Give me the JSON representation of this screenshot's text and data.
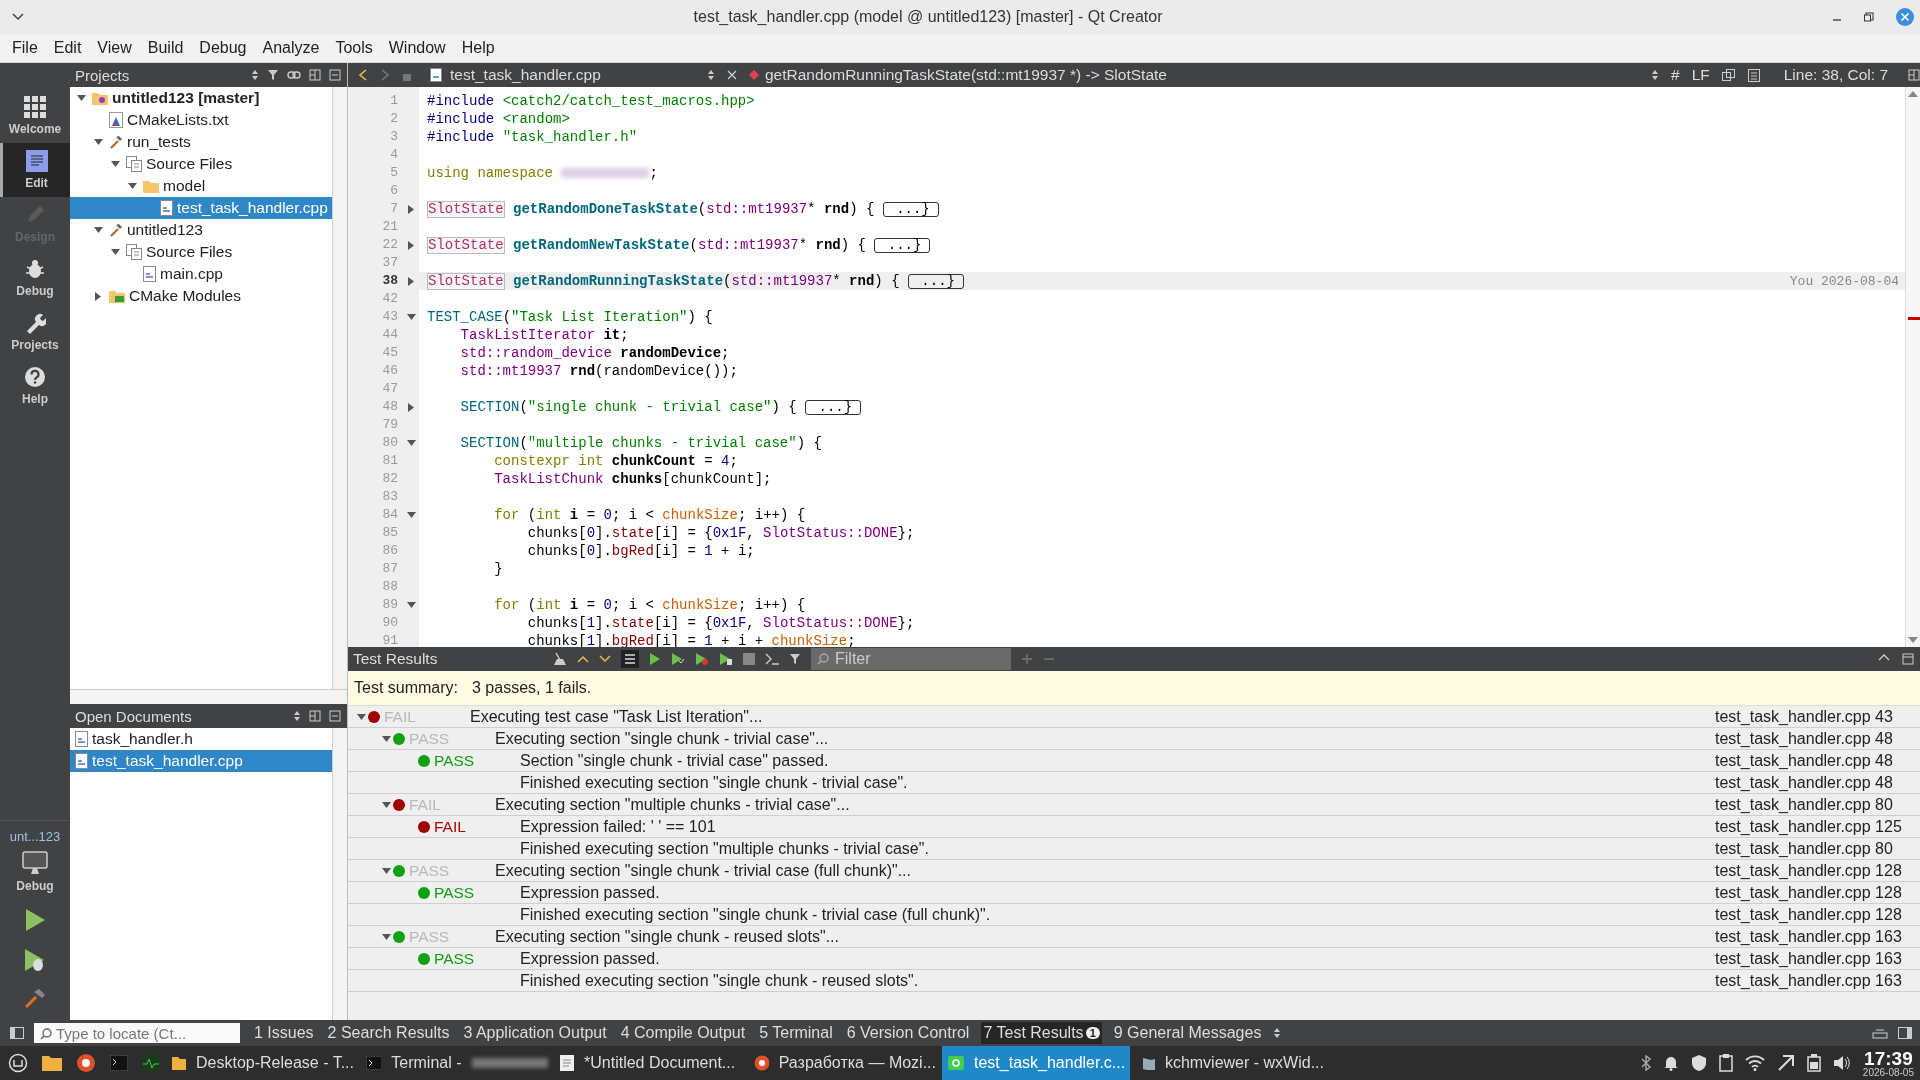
{
  "window": {
    "title": "test_task_handler.cpp (model @ untitled123) [master] - Qt Creator"
  },
  "menu": [
    "File",
    "Edit",
    "View",
    "Build",
    "Debug",
    "Analyze",
    "Tools",
    "Window",
    "Help"
  ],
  "modes": [
    {
      "label": "Welcome",
      "selected": false,
      "disabled": false
    },
    {
      "label": "Edit",
      "selected": true,
      "disabled": false
    },
    {
      "label": "Design",
      "selected": false,
      "disabled": true
    },
    {
      "label": "Debug",
      "selected": false,
      "disabled": false
    },
    {
      "label": "Projects",
      "selected": false,
      "disabled": false
    },
    {
      "label": "Help",
      "selected": false,
      "disabled": false
    }
  ],
  "kit": {
    "project": "unt...123",
    "build": "Debug"
  },
  "projects": {
    "title": "Projects",
    "tree": [
      {
        "label": "untitled123 [master]",
        "kind": "project",
        "expanded": true,
        "selected": false,
        "children": [
          {
            "label": "CMakeLists.txt",
            "kind": "cmake",
            "selected": false
          },
          {
            "label": "run_tests",
            "kind": "target",
            "expanded": true,
            "selected": false,
            "children": [
              {
                "label": "Source Files",
                "kind": "group",
                "expanded": true,
                "selected": false,
                "children": [
                  {
                    "label": "model",
                    "kind": "folder",
                    "expanded": true,
                    "selected": false,
                    "children": [
                      {
                        "label": "test_task_handler.cpp",
                        "kind": "cpp",
                        "selected": true
                      }
                    ]
                  }
                ]
              }
            ]
          },
          {
            "label": "untitled123",
            "kind": "target",
            "expanded": true,
            "selected": false,
            "children": [
              {
                "label": "Source Files",
                "kind": "group",
                "expanded": true,
                "selected": false,
                "children": [
                  {
                    "label": "main.cpp",
                    "kind": "cpp",
                    "selected": false
                  }
                ]
              }
            ]
          },
          {
            "label": "CMake Modules",
            "kind": "modules",
            "expanded": false,
            "selected": false
          }
        ]
      }
    ]
  },
  "open_documents": {
    "title": "Open Documents",
    "items": [
      {
        "label": "task_handler.h",
        "selected": false
      },
      {
        "label": "test_task_handler.cpp",
        "selected": true
      }
    ]
  },
  "editor": {
    "file": "test_task_handler.cpp",
    "symbol": "getRandomRunningTaskState(std::mt19937 *) -> SlotState",
    "hash": "#",
    "line_ending": "LF",
    "position": "Line: 38, Col: 7",
    "lines": [
      {
        "number": "1",
        "tokens": [
          {
            "kind": "pp",
            "text": "#include "
          },
          {
            "kind": "str",
            "text": "<catch2/catch_test_macros.hpp>"
          }
        ]
      },
      {
        "number": "2",
        "tokens": [
          {
            "kind": "pp",
            "text": "#include "
          },
          {
            "kind": "str",
            "text": "<random>"
          }
        ]
      },
      {
        "number": "3",
        "tokens": [
          {
            "kind": "pp",
            "text": "#include "
          },
          {
            "kind": "str",
            "text": "\"task_handler.h\""
          }
        ]
      },
      {
        "number": "4"
      },
      {
        "number": "5",
        "tokens": [
          {
            "kind": "kw",
            "text": "using namespace "
          },
          {
            "kind": "redacted"
          },
          {
            "kind": "plain",
            "text": ";"
          }
        ]
      },
      {
        "number": "6"
      },
      {
        "number": "7",
        "expanded": false,
        "tokens": [
          {
            "kind": "boxtype",
            "text": "SlotState"
          },
          {
            "kind": "fn",
            "text": " getRandomDoneTaskState"
          },
          {
            "kind": "plain",
            "text": "("
          },
          {
            "kind": "type",
            "text": "std::mt19937"
          },
          {
            "kind": "plain",
            "text": "* "
          },
          {
            "kind": "bold",
            "text": "rnd"
          },
          {
            "kind": "plain",
            "text": ") { "
          },
          {
            "kind": "folded",
            "text": " ...}"
          }
        ]
      },
      {
        "number": "21"
      },
      {
        "number": "22",
        "expanded": false,
        "tokens": [
          {
            "kind": "boxtype",
            "text": "SlotState"
          },
          {
            "kind": "fn",
            "text": " getRandomNewTaskState"
          },
          {
            "kind": "plain",
            "text": "("
          },
          {
            "kind": "type",
            "text": "std::mt19937"
          },
          {
            "kind": "plain",
            "text": "* "
          },
          {
            "kind": "bold",
            "text": "rnd"
          },
          {
            "kind": "plain",
            "text": ") { "
          },
          {
            "kind": "folded",
            "text": " ...}"
          }
        ]
      },
      {
        "number": "37"
      },
      {
        "number": "38",
        "expanded": false,
        "current": true,
        "blame": "You 2026-08-04",
        "tokens": [
          {
            "kind": "boxtype",
            "text": "SlotState"
          },
          {
            "kind": "fn",
            "text": " getRandomRunningTaskState"
          },
          {
            "kind": "plain",
            "text": "("
          },
          {
            "kind": "type",
            "text": "std::mt19937"
          },
          {
            "kind": "plain",
            "text": "* "
          },
          {
            "kind": "bold",
            "text": "rnd"
          },
          {
            "kind": "plain",
            "text": ") { "
          },
          {
            "kind": "folded",
            "text": " ...}"
          }
        ]
      },
      {
        "number": "42"
      },
      {
        "number": "43",
        "expanded": true,
        "tokens": [
          {
            "kind": "macro",
            "text": "TEST_CASE"
          },
          {
            "kind": "plain",
            "text": "("
          },
          {
            "kind": "str",
            "text": "\"Task List Iteration\""
          },
          {
            "kind": "plain",
            "text": ") {"
          }
        ]
      },
      {
        "number": "44",
        "tokens": [
          {
            "kind": "type",
            "text": "    TaskListIterator"
          },
          {
            "kind": "bold",
            "text": " it"
          },
          {
            "kind": "plain",
            "text": ";"
          }
        ]
      },
      {
        "number": "45",
        "tokens": [
          {
            "kind": "type",
            "text": "    std::random_device"
          },
          {
            "kind": "bold",
            "text": " randomDevice"
          },
          {
            "kind": "plain",
            "text": ";"
          }
        ]
      },
      {
        "number": "46",
        "tokens": [
          {
            "kind": "type",
            "text": "    std::mt19937"
          },
          {
            "kind": "bold",
            "text": " rnd"
          },
          {
            "kind": "plain",
            "text": "(randomDevice());"
          }
        ]
      },
      {
        "number": "47"
      },
      {
        "number": "48",
        "expanded": false,
        "tokens": [
          {
            "kind": "macro",
            "text": "    SECTION"
          },
          {
            "kind": "plain",
            "text": "("
          },
          {
            "kind": "str",
            "text": "\"single chunk - trivial case\""
          },
          {
            "kind": "plain",
            "text": ") { "
          },
          {
            "kind": "folded",
            "text": " ...}"
          }
        ]
      },
      {
        "number": "79"
      },
      {
        "number": "80",
        "expanded": true,
        "tokens": [
          {
            "kind": "macro",
            "text": "    SECTION"
          },
          {
            "kind": "plain",
            "text": "("
          },
          {
            "kind": "str",
            "text": "\"multiple chunks - trivial case\""
          },
          {
            "kind": "plain",
            "text": ") {"
          }
        ]
      },
      {
        "number": "81",
        "tokens": [
          {
            "kind": "kw",
            "text": "        constexpr int"
          },
          {
            "kind": "bold",
            "text": " chunkCount"
          },
          {
            "kind": "plain",
            "text": " = "
          },
          {
            "kind": "num",
            "text": "4"
          },
          {
            "kind": "plain",
            "text": ";"
          }
        ]
      },
      {
        "number": "82",
        "tokens": [
          {
            "kind": "type",
            "text": "        TaskListChunk"
          },
          {
            "kind": "bold",
            "text": " chunks"
          },
          {
            "kind": "plain",
            "text": "[chunkCount];"
          }
        ]
      },
      {
        "number": "83"
      },
      {
        "number": "84",
        "expanded": true,
        "tokens": [
          {
            "kind": "kw",
            "text": "        for"
          },
          {
            "kind": "plain",
            "text": " ("
          },
          {
            "kind": "kw",
            "text": "int"
          },
          {
            "kind": "bold",
            "text": " i"
          },
          {
            "kind": "plain",
            "text": " = "
          },
          {
            "kind": "num",
            "text": "0"
          },
          {
            "kind": "plain",
            "text": "; i < "
          },
          {
            "kind": "field",
            "text": "chunkSize"
          },
          {
            "kind": "plain",
            "text": "; i++) {"
          }
        ]
      },
      {
        "number": "85",
        "tokens": [
          {
            "kind": "plain",
            "text": "            chunks["
          },
          {
            "kind": "num",
            "text": "0"
          },
          {
            "kind": "plain",
            "text": "]."
          },
          {
            "kind": "member",
            "text": "state"
          },
          {
            "kind": "plain",
            "text": "[i] = {"
          },
          {
            "kind": "num",
            "text": "0x1F"
          },
          {
            "kind": "plain",
            "text": ", "
          },
          {
            "kind": "type",
            "text": "SlotStatus::DONE"
          },
          {
            "kind": "plain",
            "text": "};"
          }
        ]
      },
      {
        "number": "86",
        "tokens": [
          {
            "kind": "plain",
            "text": "            chunks["
          },
          {
            "kind": "num",
            "text": "0"
          },
          {
            "kind": "plain",
            "text": "]."
          },
          {
            "kind": "member",
            "text": "bgRed"
          },
          {
            "kind": "plain",
            "text": "[i] = "
          },
          {
            "kind": "num",
            "text": "1"
          },
          {
            "kind": "plain",
            "text": " + i;"
          }
        ]
      },
      {
        "number": "87",
        "tokens": [
          {
            "kind": "plain",
            "text": "        }"
          }
        ]
      },
      {
        "number": "88"
      },
      {
        "number": "89",
        "expanded": true,
        "tokens": [
          {
            "kind": "kw",
            "text": "        for"
          },
          {
            "kind": "plain",
            "text": " ("
          },
          {
            "kind": "kw",
            "text": "int"
          },
          {
            "kind": "bold",
            "text": " i"
          },
          {
            "kind": "plain",
            "text": " = "
          },
          {
            "kind": "num",
            "text": "0"
          },
          {
            "kind": "plain",
            "text": "; i < "
          },
          {
            "kind": "field",
            "text": "chunkSize"
          },
          {
            "kind": "plain",
            "text": "; i++) {"
          }
        ]
      },
      {
        "number": "90",
        "tokens": [
          {
            "kind": "plain",
            "text": "            chunks["
          },
          {
            "kind": "num",
            "text": "1"
          },
          {
            "kind": "plain",
            "text": "]."
          },
          {
            "kind": "member",
            "text": "state"
          },
          {
            "kind": "plain",
            "text": "[i] = {"
          },
          {
            "kind": "num",
            "text": "0x1F"
          },
          {
            "kind": "plain",
            "text": ", "
          },
          {
            "kind": "type",
            "text": "SlotStatus::DONE"
          },
          {
            "kind": "plain",
            "text": "};"
          }
        ]
      },
      {
        "number": "91",
        "tokens": [
          {
            "kind": "plain",
            "text": "            chunks["
          },
          {
            "kind": "num",
            "text": "1"
          },
          {
            "kind": "plain",
            "text": "]."
          },
          {
            "kind": "member",
            "text": "bgRed"
          },
          {
            "kind": "plain",
            "text": "[i] = "
          },
          {
            "kind": "num",
            "text": "1"
          },
          {
            "kind": "plain",
            "text": " + i + "
          },
          {
            "kind": "field",
            "text": "chunkSize"
          },
          {
            "kind": "plain",
            "text": ";"
          }
        ]
      }
    ]
  },
  "test_results": {
    "title": "Test Results",
    "filter_placeholder": "Filter",
    "summary_label": "Test summary:",
    "summary": "3 passes, 1 fails.",
    "rows": [
      {
        "passed": false,
        "label": "FAIL",
        "text": "Executing test case \"Task List Iteration\"...",
        "location": "test_task_handler.cpp 43",
        "expanded": true,
        "children": [
          {
            "passed": true,
            "label": "PASS",
            "text": "Executing section \"single chunk - trivial case\"...",
            "location": "test_task_handler.cpp 48",
            "expanded": true,
            "children": [
              {
                "passed": true,
                "label": "PASS",
                "text": "Section \"single chunk - trivial case\" passed.",
                "location": "test_task_handler.cpp 48"
              },
              {
                "text": "Finished executing section \"single chunk - trivial case\".",
                "location": "test_task_handler.cpp 48"
              }
            ]
          },
          {
            "passed": false,
            "label": "FAIL",
            "text": "Executing section \"multiple chunks - trivial case\"...",
            "location": "test_task_handler.cpp 80",
            "expanded": true,
            "children": [
              {
                "passed": false,
                "label": "FAIL",
                "text": "Expression failed: ' ' == 101",
                "location": "test_task_handler.cpp 125"
              },
              {
                "text": "Finished executing section \"multiple chunks - trivial case\".",
                "location": "test_task_handler.cpp 80"
              }
            ]
          },
          {
            "passed": true,
            "label": "PASS",
            "text": "Executing section \"single chunk - trivial case (full chunk)\"...",
            "location": "test_task_handler.cpp 128",
            "expanded": true,
            "children": [
              {
                "passed": true,
                "label": "PASS",
                "text": "Expression passed.",
                "location": "test_task_handler.cpp 128"
              },
              {
                "text": "Finished executing section \"single chunk - trivial case (full chunk)\".",
                "location": "test_task_handler.cpp 128"
              }
            ]
          },
          {
            "passed": true,
            "label": "PASS",
            "text": "Executing section \"single chunk - reused slots\"...",
            "location": "test_task_handler.cpp 163",
            "expanded": true,
            "children": [
              {
                "passed": true,
                "label": "PASS",
                "text": "Expression passed.",
                "location": "test_task_handler.cpp 163"
              },
              {
                "text": "Finished executing section \"single chunk - reused slots\".",
                "location": "test_task_handler.cpp 163"
              }
            ]
          }
        ]
      }
    ]
  },
  "output_bar": {
    "locate_placeholder": "Type to locate (Ct...",
    "tabs": [
      {
        "label": "1 Issues",
        "selected": false
      },
      {
        "label": "2 Search Results",
        "selected": false
      },
      {
        "label": "3 Application Output",
        "selected": false
      },
      {
        "label": "4 Compile Output",
        "selected": false
      },
      {
        "label": "5 Terminal",
        "selected": false
      },
      {
        "label": "6 Version Control",
        "selected": false
      },
      {
        "label": "7 Test Results",
        "selected": true,
        "badge": "1"
      },
      {
        "label": "9 General Messages",
        "selected": false
      }
    ]
  },
  "taskbar": {
    "windows": [
      {
        "label": "Desktop-Release - T...",
        "selected": false
      },
      {
        "label": "Terminal -",
        "selected": false,
        "redacted": true
      },
      {
        "label": "*Untitled Document...",
        "selected": false
      },
      {
        "label": "Разработка — Mozi...",
        "selected": false
      },
      {
        "label": "test_task_handler.c...",
        "selected": true
      },
      {
        "label": "kchmviewer - wxWid...",
        "selected": false
      }
    ],
    "time": "17:39",
    "date": "2026-08-05"
  }
}
